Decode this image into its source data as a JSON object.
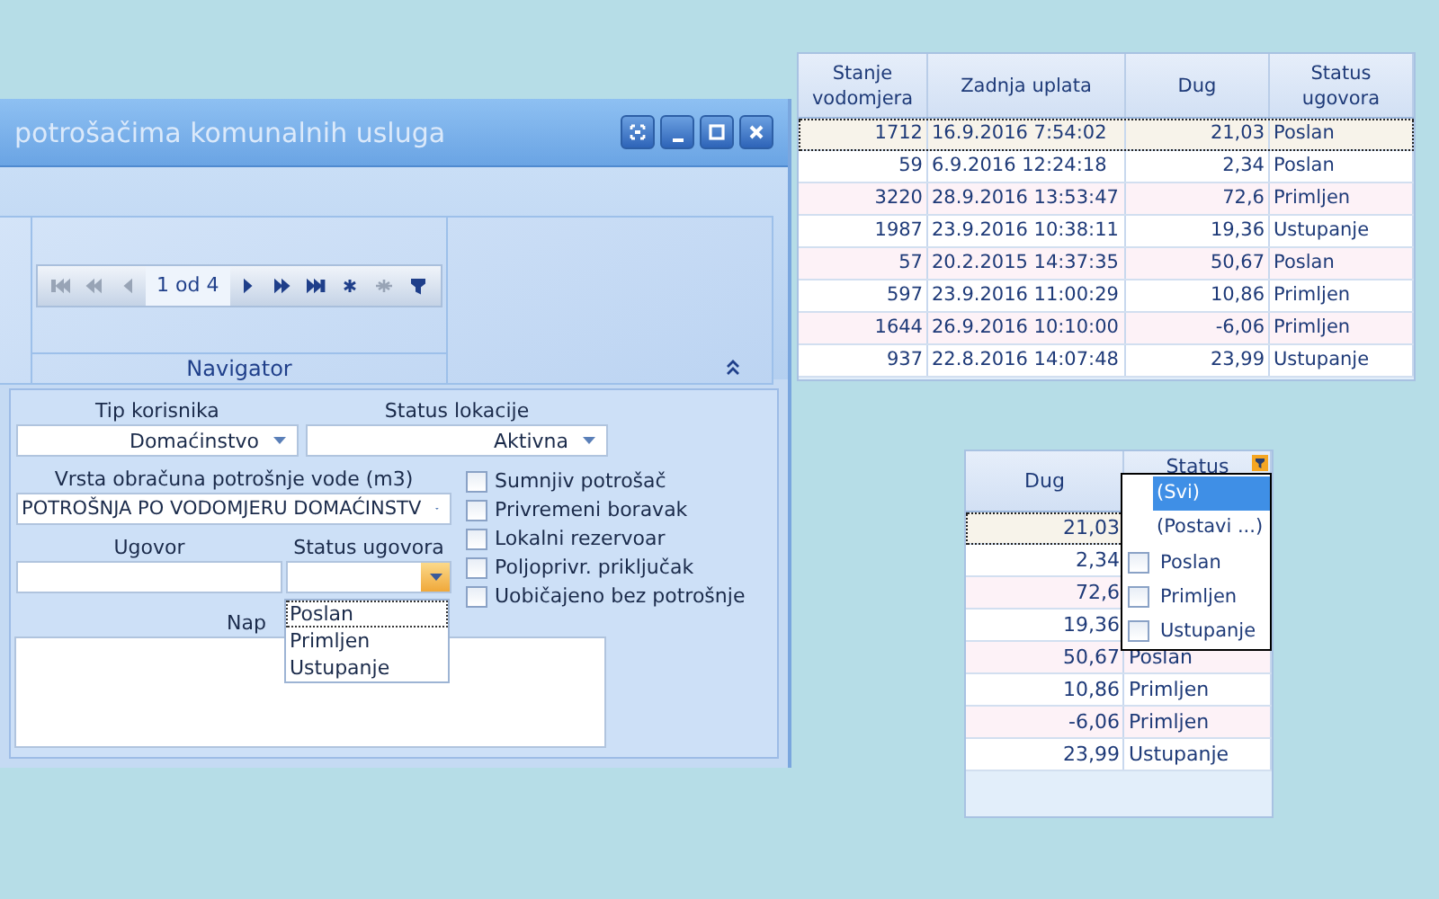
{
  "window": {
    "title": "potrošačima komunalnih usluga",
    "controls": [
      {
        "kind": "restore"
      },
      {
        "kind": "minimize"
      },
      {
        "kind": "maximize"
      },
      {
        "kind": "close"
      }
    ]
  },
  "navigator": {
    "label": "Navigator",
    "position": "1 od 4",
    "buttons": [
      {
        "kind": "first",
        "disabled": true
      },
      {
        "kind": "prev_page",
        "disabled": true
      },
      {
        "kind": "prev",
        "disabled": true
      },
      {
        "kind": "pos"
      },
      {
        "kind": "next",
        "disabled": false
      },
      {
        "kind": "next_page",
        "disabled": false
      },
      {
        "kind": "last",
        "disabled": false
      },
      {
        "kind": "add",
        "disabled": false
      },
      {
        "kind": "delete",
        "disabled": true
      },
      {
        "kind": "filter",
        "disabled": false
      }
    ]
  },
  "form": {
    "tip_korisnika": {
      "label": "Tip korisnika",
      "value": "Domaćinstvo"
    },
    "status_lokacije": {
      "label": "Status lokacije",
      "value": "Aktivna"
    },
    "vrsta_obracuna": {
      "label": "Vrsta obračuna potrošnje vode (m3)",
      "value": "POTROŠNJA PO VODOMJERU DOMAĆINSTV"
    },
    "ugovor": {
      "label": "Ugovor"
    },
    "status_ugovora": {
      "label": "Status ugovora",
      "expanded": true,
      "options": [
        {
          "label": "Poslan",
          "selected": true
        },
        {
          "label": "Primljen",
          "selected": false
        },
        {
          "label": "Ustupanje",
          "selected": false
        }
      ]
    },
    "napomena": {
      "label": "Nap"
    },
    "checkboxes": [
      {
        "label": "Sumnjiv potrošač",
        "checked": false
      },
      {
        "label": "Privremeni boravak",
        "checked": false
      },
      {
        "label": "Lokalni rezervoar",
        "checked": false
      },
      {
        "label": "Poljoprivr. priključak",
        "checked": false
      },
      {
        "label": "Uobičajeno bez potrošnje",
        "checked": false
      }
    ]
  },
  "grid": {
    "columns": [
      "Stanje vodomjera",
      "Zadnja uplata",
      "Dug",
      "Status ugovora"
    ],
    "rows": [
      {
        "cells": [
          "1712",
          "16.9.2016 7:54:02",
          "21,03",
          "Poslan"
        ],
        "selected": true
      },
      {
        "cells": [
          "59",
          "6.9.2016 12:24:18",
          "2,34",
          "Poslan"
        ],
        "selected": false
      },
      {
        "cells": [
          "3220",
          "28.9.2016 13:53:47",
          "72,6",
          "Primljen"
        ],
        "selected": false
      },
      {
        "cells": [
          "1987",
          "23.9.2016 10:38:11",
          "19,36",
          "Ustupanje"
        ],
        "selected": false
      },
      {
        "cells": [
          "57",
          "20.2.2015 14:37:35",
          "50,67",
          "Poslan"
        ],
        "selected": false
      },
      {
        "cells": [
          "597",
          "23.9.2016 11:00:29",
          "10,86",
          "Primljen"
        ],
        "selected": false
      },
      {
        "cells": [
          "1644",
          "26.9.2016 10:10:00",
          "-6,06",
          "Primljen"
        ],
        "selected": false
      },
      {
        "cells": [
          "937",
          "22.8.2016 14:07:48",
          "23,99",
          "Ustupanje"
        ],
        "selected": false
      }
    ]
  },
  "filter_grid": {
    "columns": [
      "Dug",
      "Status"
    ],
    "rows": [
      {
        "dug": "21,03",
        "selected": true
      },
      {
        "dug": "2,34",
        "selected": false
      },
      {
        "dug": "72,6",
        "selected": false
      },
      {
        "dug": "19,36",
        "selected": false
      },
      {
        "dug": "50,67",
        "status": "Poslan",
        "selected": false
      },
      {
        "dug": "10,86",
        "status": "Primljen",
        "selected": false
      },
      {
        "dug": "-6,06",
        "status": "Primljen",
        "selected": false
      },
      {
        "dug": "23,99",
        "status": "Ustupanje",
        "selected": false
      }
    ],
    "filter_menu": [
      {
        "kind": "option",
        "label": "(Svi)",
        "selected": true
      },
      {
        "kind": "option",
        "label": "(Postavi ...)",
        "selected": false
      },
      {
        "kind": "check",
        "label": "Poslan",
        "checked": false
      },
      {
        "kind": "check",
        "label": "Primljen",
        "checked": false
      },
      {
        "kind": "check",
        "label": "Ustupanje",
        "checked": false
      }
    ]
  }
}
